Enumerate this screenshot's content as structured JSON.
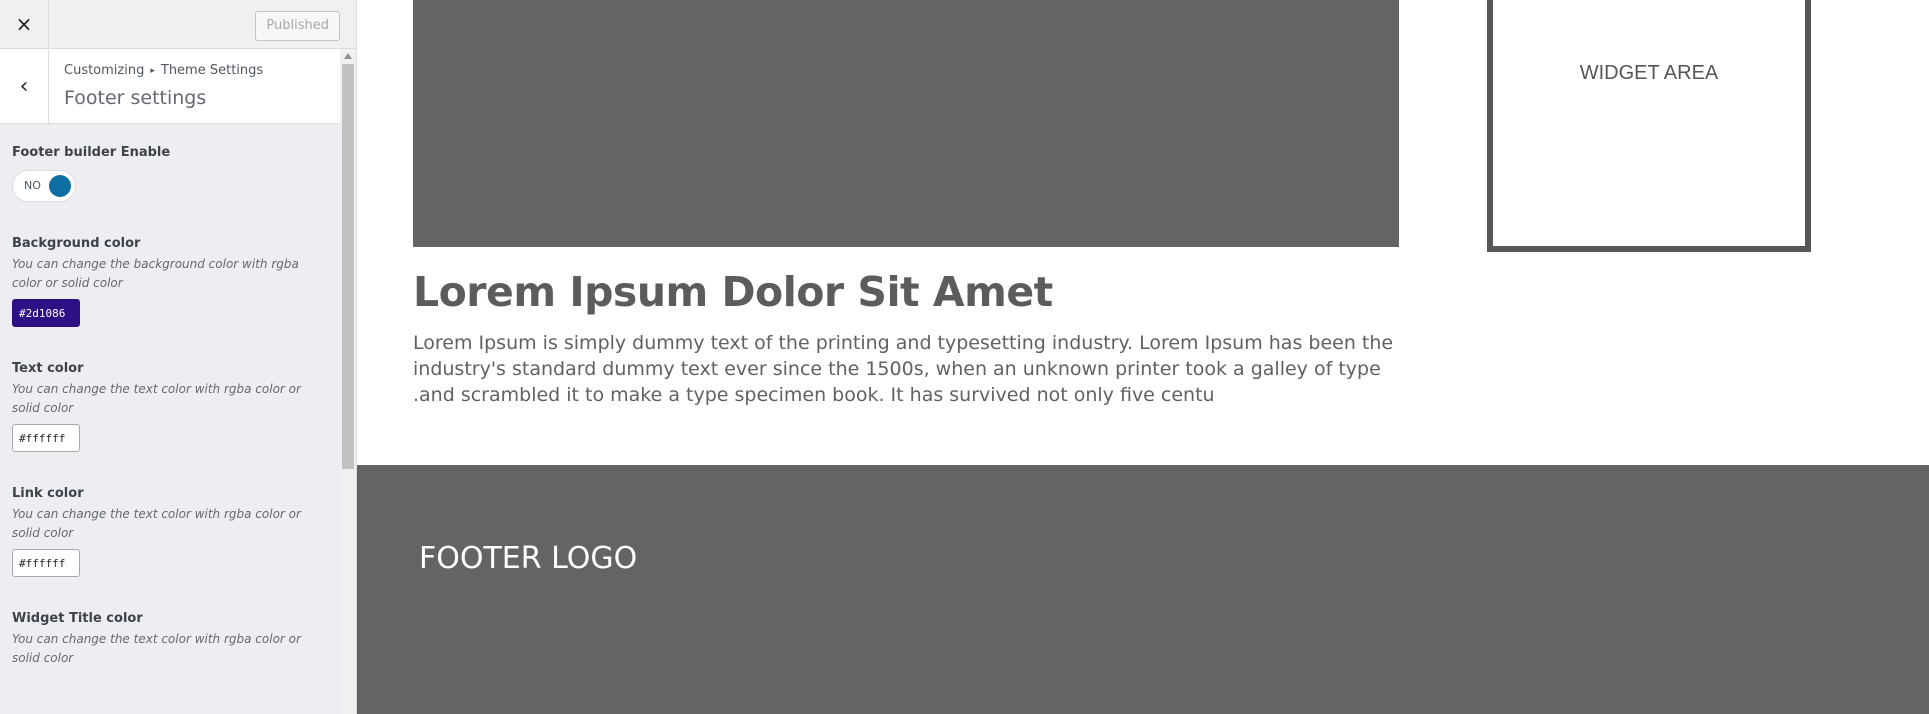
{
  "topbar": {
    "close_icon": "×",
    "publish_label": "Published"
  },
  "section": {
    "back_icon": "‹",
    "breadcrumb_root": "Customizing",
    "breadcrumb_sep": "▸",
    "breadcrumb_leaf": "Theme Settings",
    "title": "Footer settings"
  },
  "controls": {
    "footer_builder": {
      "label": "Footer builder Enable",
      "toggle_text": "NO"
    },
    "bg_color": {
      "label": "Background color",
      "desc": "You can change the background color with rgba color or solid color",
      "value": "#2d1086"
    },
    "text_color": {
      "label": "Text color",
      "desc": "You can change the text color with rgba color or solid color",
      "value": "#ffffff"
    },
    "link_color": {
      "label": "Link color",
      "desc": "You can change the text color with rgba color or solid color",
      "value": "#ffffff"
    },
    "widget_title_color": {
      "label": "Widget Title color",
      "desc": "You can change the text color with rgba color or solid color"
    }
  },
  "preview": {
    "widget_area": "WIDGET AREA",
    "post_title": "Lorem Ipsum Dolor Sit Amet",
    "post_body": "Lorem Ipsum is simply dummy text of the printing and typesetting industry. Lorem Ipsum has been the industry's standard dummy text ever since the 1500s, when an unknown printer took a galley of type .and scrambled it to make a type specimen book. It has survived not only five centu",
    "footer_logo": "FOOTER LOGO"
  },
  "colors": {
    "accent": "#0e6ea1",
    "bg_chip": "#2d1086",
    "preview_gray": "#646464"
  }
}
